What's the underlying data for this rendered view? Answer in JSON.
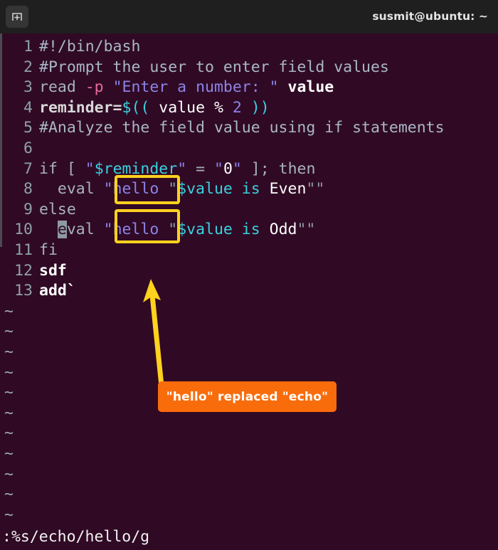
{
  "window": {
    "title": "susmit@ubuntu: ~",
    "new_tab_icon": "new-tab-icon"
  },
  "editor": {
    "name": "vim",
    "line_numbers": [
      "1",
      "2",
      "3",
      "4",
      "5",
      "6",
      "7",
      "8",
      "9",
      "10",
      "11",
      "12",
      "13"
    ],
    "lines": [
      {
        "n": "1",
        "text": "#!/bin/bash"
      },
      {
        "n": "2",
        "text": "#Prompt the user to enter field values"
      },
      {
        "n": "3",
        "text": "read -p \"Enter a number: \" value"
      },
      {
        "n": "4",
        "text": "reminder=$(( value % 2 ))"
      },
      {
        "n": "5",
        "text": "#Analyze the field value using if statements"
      },
      {
        "n": "6",
        "text": ""
      },
      {
        "n": "7",
        "text": "if [ \"$reminder\" = \"0\" ]; then"
      },
      {
        "n": "8",
        "text": "  eval \"hello \"$value is Even\"\""
      },
      {
        "n": "9",
        "text": "else"
      },
      {
        "n": "10",
        "text": "  eval \"hello \"$value is Odd\"\""
      },
      {
        "n": "11",
        "text": "fi"
      },
      {
        "n": "12",
        "text": "sdf"
      },
      {
        "n": "13",
        "text": "add`"
      }
    ],
    "tokens": {
      "l1": [
        {
          "t": "#!/bin/bash",
          "c": "c-comment"
        }
      ],
      "l2": [
        {
          "t": "#Prompt the user to enter field values",
          "c": "c-comment"
        }
      ],
      "l3": [
        {
          "t": "read ",
          "c": "c-plain"
        },
        {
          "t": "-p",
          "c": "c-op"
        },
        {
          "t": " ",
          "c": "c-plain"
        },
        {
          "t": "\"Enter a number: \"",
          "c": "c-string"
        },
        {
          "t": " ",
          "c": "c-plain"
        },
        {
          "t": "value",
          "c": "c-white c-bold"
        }
      ],
      "l4": [
        {
          "t": "reminder=",
          "c": "c-ident"
        },
        {
          "t": "$((",
          "c": "c-var"
        },
        {
          "t": " value % ",
          "c": "c-white"
        },
        {
          "t": "2",
          "c": "c-num"
        },
        {
          "t": " ",
          "c": "c-white"
        },
        {
          "t": "))",
          "c": "c-var"
        }
      ],
      "l5": [
        {
          "t": "#Analyze the field value using if statements",
          "c": "c-comment"
        }
      ],
      "l6": [],
      "l7": [
        {
          "t": "if [ ",
          "c": "c-keyword"
        },
        {
          "t": "\"",
          "c": "c-string"
        },
        {
          "t": "$reminder",
          "c": "c-var"
        },
        {
          "t": "\"",
          "c": "c-string"
        },
        {
          "t": " = ",
          "c": "c-keyword"
        },
        {
          "t": "\"",
          "c": "c-string"
        },
        {
          "t": "0",
          "c": "c-white"
        },
        {
          "t": "\"",
          "c": "c-string"
        },
        {
          "t": " ]; then",
          "c": "c-keyword"
        }
      ],
      "l8": [
        {
          "t": "  eval ",
          "c": "c-plain"
        },
        {
          "t": "\"hello ",
          "c": "c-string"
        },
        {
          "t": "\"",
          "c": "c-gray"
        },
        {
          "t": "$value",
          "c": "c-var"
        },
        {
          "t": " is ",
          "c": "c-var"
        },
        {
          "t": "Even",
          "c": "c-white"
        },
        {
          "t": "\"\"",
          "c": "c-gray"
        }
      ],
      "l9": [
        {
          "t": "else",
          "c": "c-plain"
        }
      ],
      "l10": [
        {
          "t": "  ",
          "c": "c-plain"
        },
        {
          "t": "e",
          "c": "cursor-blk"
        },
        {
          "t": "val ",
          "c": "c-plain"
        },
        {
          "t": "\"hello ",
          "c": "c-string"
        },
        {
          "t": "\"",
          "c": "c-gray"
        },
        {
          "t": "$value",
          "c": "c-var"
        },
        {
          "t": " is ",
          "c": "c-var"
        },
        {
          "t": "Odd",
          "c": "c-white"
        },
        {
          "t": "\"\"",
          "c": "c-gray"
        }
      ],
      "l11": [
        {
          "t": "fi",
          "c": "c-plain"
        }
      ],
      "l12": [
        {
          "t": "sdf",
          "c": "c-white c-bold"
        }
      ],
      "l13": [
        {
          "t": "add`",
          "c": "c-white c-bold"
        }
      ]
    },
    "empty_line_markers": [
      "~",
      "~",
      "~",
      "~",
      "~",
      "~",
      "~",
      "~",
      "~",
      "~",
      "~"
    ],
    "command_line": ":%s/echo/hello/g"
  },
  "annotation": {
    "callout_text": "\"hello\" replaced \"echo\"",
    "callout_color": "#f96c0c",
    "callout_text_color": "#ffffff",
    "arrow_color": "#ffd21e",
    "highlight_box_color": "#ffd21e",
    "highlight_targets": [
      "line-8-hello-string",
      "line-10-hello-string"
    ]
  },
  "colors": {
    "terminal_background": "#300a24",
    "titlebar_background": "#1f1f1f",
    "title_text": "#e6e6e6",
    "line_number": "#8fa0ac",
    "comment": "#a9b7c6",
    "string": "#8b84e8",
    "variable": "#3ad1e0",
    "operator": "#e86b9a",
    "cursor": "#8d9aa3"
  }
}
